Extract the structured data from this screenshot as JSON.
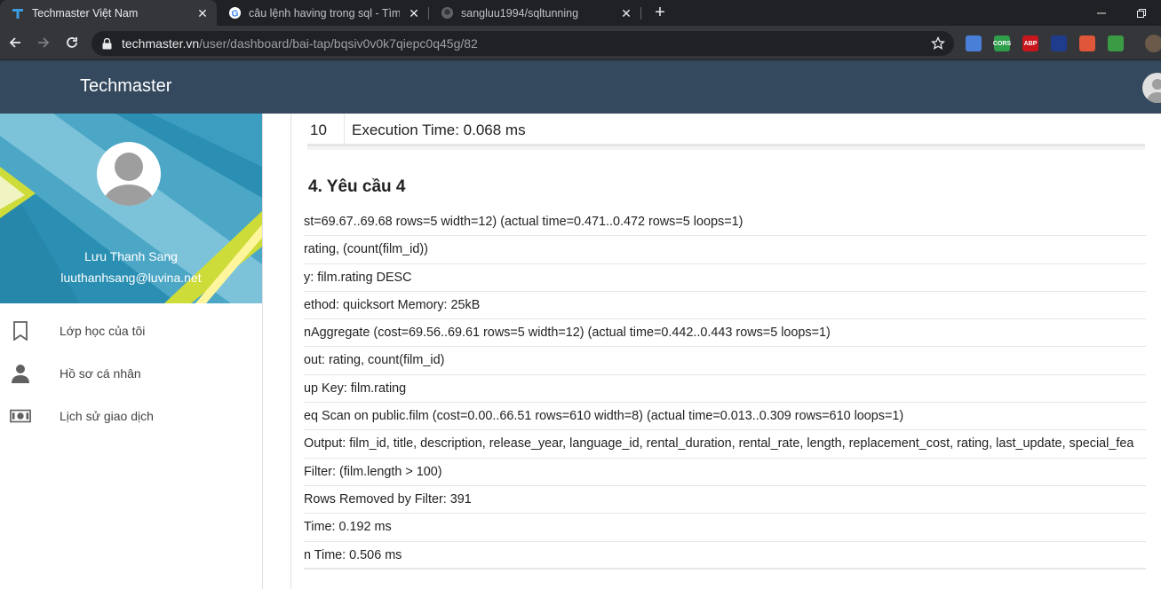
{
  "browser": {
    "tabs": [
      {
        "title": "Techmaster Việt Nam",
        "active": true,
        "favicon": "techmaster-favicon"
      },
      {
        "title": "câu lệnh having trong sql - Tìm v",
        "active": false,
        "favicon": "google-favicon"
      },
      {
        "title": "sangluu1994/sqltunning",
        "active": false,
        "favicon": "github-favicon"
      }
    ],
    "url_host": "techmaster.vn",
    "url_path": "/user/dashboard/bai-tap/bqsiv0v0k7qiepc0q45g/82",
    "extensions": [
      {
        "name": "google-translate-icon",
        "color": "#4a7fd7",
        "label": ""
      },
      {
        "name": "cors-icon",
        "color": "#2e9e4a",
        "label": "CORS"
      },
      {
        "name": "adblock-plus-icon",
        "color": "#c8161d",
        "label": "ABP"
      },
      {
        "name": "extension-j-icon",
        "color": "#1f3c8c",
        "label": ""
      },
      {
        "name": "extension-share-icon",
        "color": "#e0563b",
        "label": ""
      },
      {
        "name": "download-helper-icon",
        "color": "#3b9a44",
        "label": ""
      }
    ]
  },
  "app": {
    "brand": "Techmaster",
    "colors": {
      "appbar": "#34495e",
      "card": "#2a8fb3"
    }
  },
  "sidebar": {
    "name": "Lưu Thanh Sang",
    "email": "luuthanhsang@luvina.net",
    "items": [
      {
        "label": "Lớp học của tôi",
        "icon": "bookmark-icon"
      },
      {
        "label": "Hồ sơ cá nhân",
        "icon": "person-icon"
      },
      {
        "label": "Lịch sử giao dịch",
        "icon": "money-icon"
      }
    ]
  },
  "main": {
    "prev_row": {
      "num": "10",
      "text": "Execution Time: 0.068 ms"
    },
    "section_title": "4. Yêu cầu 4",
    "plan_rows": [
      "st=69.67..69.68 rows=5 width=12) (actual time=0.471..0.472 rows=5 loops=1)",
      "rating, (count(film_id))",
      "y: film.rating DESC",
      "ethod: quicksort  Memory: 25kB",
      "nAggregate  (cost=69.56..69.61 rows=5 width=12) (actual time=0.442..0.443 rows=5 loops=1)",
      "out: rating, count(film_id)",
      "up Key: film.rating",
      "eq Scan on public.film  (cost=0.00..66.51 rows=610 width=8) (actual time=0.013..0.309 rows=610 loops=1)",
      "Output: film_id, title, description, release_year, language_id, rental_duration, rental_rate, length, replacement_cost, rating, last_update, special_fea",
      "Filter: (film.length > 100)",
      "Rows Removed by Filter: 391",
      " Time: 0.192 ms",
      "n Time: 0.506 ms"
    ]
  }
}
